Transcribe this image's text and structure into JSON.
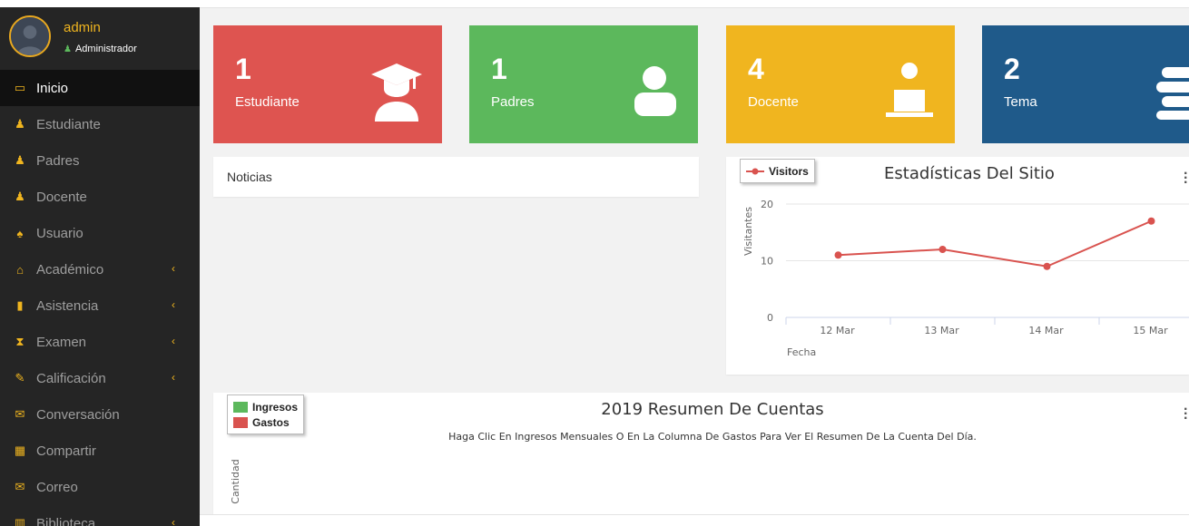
{
  "profile": {
    "username": "admin",
    "role": "Administrador",
    "role_icon": "user-icon"
  },
  "menu": [
    {
      "label": "Inicio",
      "icon": "laptop-icon",
      "active": true,
      "submenu": false
    },
    {
      "label": "Estudiante",
      "icon": "graduate-icon",
      "active": false,
      "submenu": false
    },
    {
      "label": "Padres",
      "icon": "user-icon",
      "active": false,
      "submenu": false
    },
    {
      "label": "Docente",
      "icon": "teacher-icon",
      "active": false,
      "submenu": false
    },
    {
      "label": "Usuario",
      "icon": "users-icon",
      "active": false,
      "submenu": false
    },
    {
      "label": "Académico",
      "icon": "building-icon",
      "active": false,
      "submenu": true
    },
    {
      "label": "Asistencia",
      "icon": "clipboard-icon",
      "active": false,
      "submenu": true
    },
    {
      "label": "Examen",
      "icon": "hourglass-icon",
      "active": false,
      "submenu": true
    },
    {
      "label": "Calificación",
      "icon": "edit-icon",
      "active": false,
      "submenu": true
    },
    {
      "label": "Conversación",
      "icon": "envelope-icon",
      "active": false,
      "submenu": false
    },
    {
      "label": "Compartir",
      "icon": "film-icon",
      "active": false,
      "submenu": false
    },
    {
      "label": "Correo",
      "icon": "envelope-open-icon",
      "active": false,
      "submenu": false
    },
    {
      "label": "Biblioteca",
      "icon": "book-icon",
      "active": false,
      "submenu": true
    }
  ],
  "cards": [
    {
      "count": "1",
      "label": "Estudiante",
      "icon": "graduate-icon",
      "color": "#de5450"
    },
    {
      "count": "1",
      "label": "Padres",
      "icon": "user-icon",
      "color": "#5cb85c"
    },
    {
      "count": "4",
      "label": "Docente",
      "icon": "teacher-icon",
      "color": "#f0b51f"
    },
    {
      "count": "2",
      "label": "Tema",
      "icon": "books-icon",
      "color": "#1f5a8a"
    }
  ],
  "news": {
    "title": "Noticias"
  },
  "chart_data": [
    {
      "type": "line",
      "title": "Estadísticas Del Sitio",
      "xlabel": "Fecha",
      "ylabel": "Visitantes",
      "categories": [
        "12 Mar",
        "13 Mar",
        "14 Mar",
        "15 Mar"
      ],
      "series": [
        {
          "name": "Visitors",
          "values": [
            11,
            12,
            9,
            17
          ],
          "color": "#d9534f"
        }
      ],
      "ylim": [
        0,
        20
      ],
      "yticks": [
        0,
        10,
        20
      ],
      "grid": true,
      "legend": "top-left"
    },
    {
      "type": "bar",
      "title": "2019 Resumen De Cuentas",
      "subtitle": "Haga Clic En Ingresos Mensuales O En La Columna De Gastos Para Ver El Resumen De La Cuenta Del Día.",
      "ylabel": "Cantidad",
      "series": [
        {
          "name": "Ingresos",
          "color": "#5cb85c"
        },
        {
          "name": "Gastos",
          "color": "#d9534f"
        }
      ],
      "legend": "top-left"
    }
  ]
}
